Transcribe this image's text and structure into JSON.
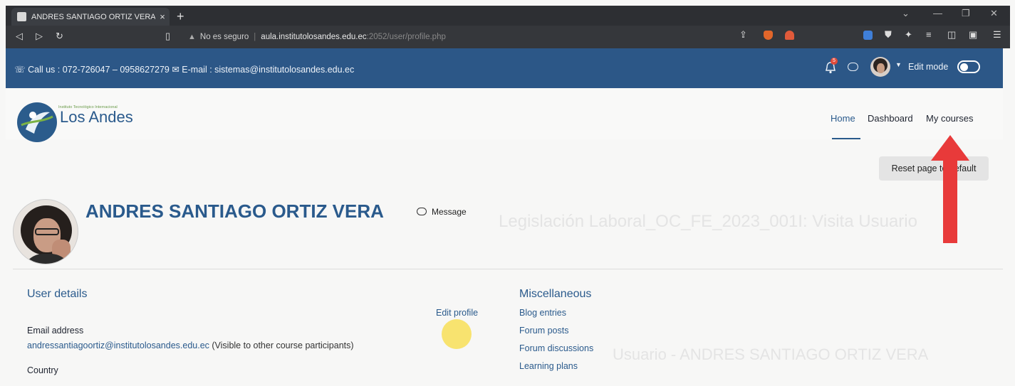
{
  "browser": {
    "tab_title": "ANDRES SANTIAGO ORTIZ VERA",
    "tab_close": "×",
    "new_tab": "+",
    "url_warning": "No es seguro",
    "url_host": "aula.institutolosandes.edu.ec",
    "url_path": ":2052/user/profile.php"
  },
  "topbar": {
    "contact": "☏ Call us : 072-726047 – 0958627279  ✉ E-mail : sistemas@institutolosandes.edu.ec",
    "notification_count": "5",
    "edit_mode_label": "Edit mode"
  },
  "navbar": {
    "logo_tagline": "Instituto Tecnológico Internacional",
    "logo_text": "Los Andes",
    "items": [
      {
        "label": "Home"
      },
      {
        "label": "Dashboard"
      },
      {
        "label": "My courses"
      }
    ]
  },
  "page": {
    "reset_button": "Reset page to default",
    "ghost_heading": "Legislación Laboral_OC_FE_2023_001I: Visita Usuario",
    "ghost_heading2": "Usuario - ANDRES SANTIAGO ORTIZ VERA"
  },
  "profile": {
    "name": "ANDRES SANTIAGO ORTIZ VERA",
    "message_label": "Message"
  },
  "user_details": {
    "title": "User details",
    "edit_profile": "Edit profile",
    "email_label": "Email address",
    "email": "andressantiagoortiz@institutolosandes.edu.ec",
    "email_note": " (Visible to other course participants)",
    "country_label": "Country"
  },
  "misc": {
    "title": "Miscellaneous",
    "links": [
      {
        "label": "Blog entries"
      },
      {
        "label": "Forum posts"
      },
      {
        "label": "Forum discussions"
      },
      {
        "label": "Learning plans"
      }
    ]
  },
  "colors": {
    "brand_blue": "#2c5787",
    "link_blue": "#2a5a8c",
    "annotation_arrow": "#e83a3a",
    "annotation_dot": "#f7e060"
  }
}
